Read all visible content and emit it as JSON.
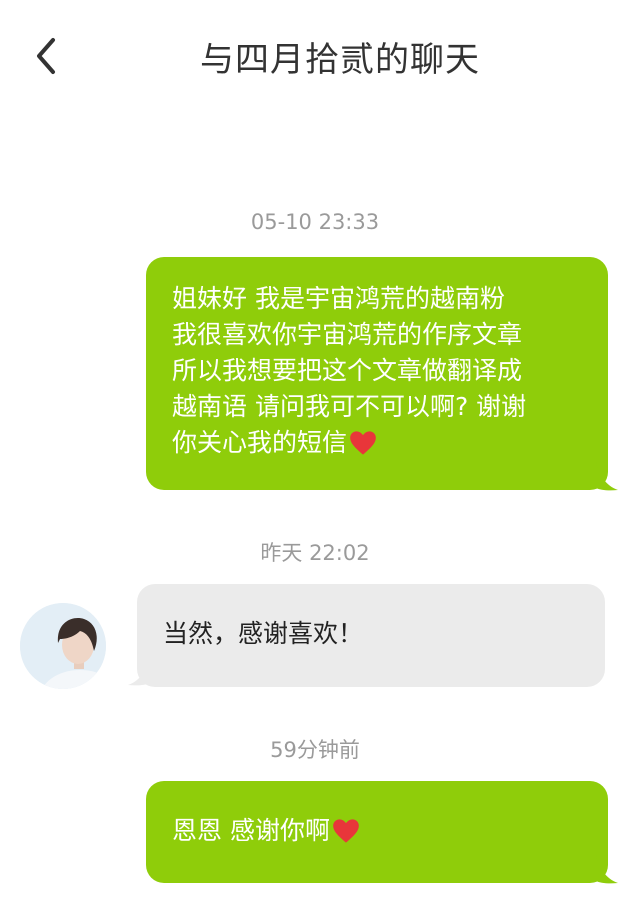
{
  "header": {
    "title": "与四月拾贰的聊天",
    "back_icon": "chevron-left-icon"
  },
  "messages": [
    {
      "timestamp": "05-10 23:33",
      "direction": "outgoing",
      "lines": [
        "姐妹好 我是宇宙鸿荒的越南粉",
        "我很喜欢你宇宙鸿荒的作序文章",
        "所以我想要把这个文章做翻译成",
        "越南语 请问我可不可以啊? 谢谢",
        "你关心我的短信"
      ],
      "emoji": "heart-icon"
    },
    {
      "timestamp": "昨天 22:02",
      "direction": "incoming",
      "lines": [
        "当然，感谢喜欢！"
      ],
      "avatar": "avatar"
    },
    {
      "timestamp": "59分钟前",
      "direction": "outgoing",
      "lines": [
        "恩恩 感谢你啊"
      ],
      "emoji": "heart-icon"
    }
  ],
  "colors": {
    "outgoing_bubble": "#8fcd0a",
    "incoming_bubble": "#ebebeb",
    "timestamp_text": "#9a9a9a",
    "heart": "#e8363a"
  }
}
